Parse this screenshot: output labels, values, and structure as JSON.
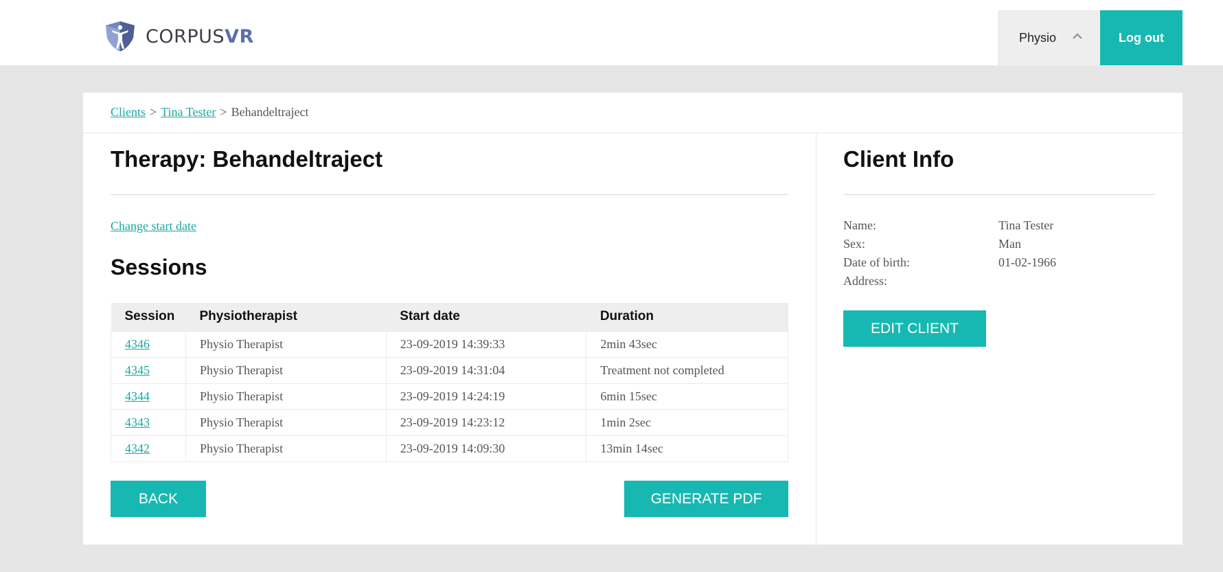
{
  "header": {
    "logo_text_a": "CORPUS",
    "logo_text_b": "VR",
    "user_name": "Physio",
    "logout_label": "Log out"
  },
  "breadcrumb": {
    "clients": "Clients",
    "separator": ">",
    "client": "Tina Tester",
    "current": "Behandeltraject"
  },
  "therapy": {
    "title": "Therapy: Behandeltraject",
    "change_start_date": "Change start date",
    "sessions_title": "Sessions"
  },
  "table": {
    "headers": [
      "Session",
      "Physiotherapist",
      "Start date",
      "Duration"
    ],
    "rows": [
      {
        "session": "4346",
        "physio": "Physio Therapist",
        "start": "23-09-2019 14:39:33",
        "duration": "2min 43sec"
      },
      {
        "session": "4345",
        "physio": "Physio Therapist",
        "start": "23-09-2019 14:31:04",
        "duration": "Treatment not completed"
      },
      {
        "session": "4344",
        "physio": "Physio Therapist",
        "start": "23-09-2019 14:24:19",
        "duration": "6min 15sec"
      },
      {
        "session": "4343",
        "physio": "Physio Therapist",
        "start": "23-09-2019 14:23:12",
        "duration": "1min 2sec"
      },
      {
        "session": "4342",
        "physio": "Physio Therapist",
        "start": "23-09-2019 14:09:30",
        "duration": "13min 14sec"
      }
    ]
  },
  "buttons": {
    "back": "BACK",
    "generate_pdf": "GENERATE PDF",
    "edit_client": "EDIT CLIENT"
  },
  "client_info": {
    "title": "Client Info",
    "name_label": "Name:",
    "name_value": "Tina Tester",
    "sex_label": "Sex:",
    "sex_value": "Man",
    "dob_label": "Date of birth:",
    "dob_value": "01-02-1966",
    "address_label": "Address:",
    "address_value": ""
  },
  "colors": {
    "accent": "#17b8b1",
    "link": "#17a9a1",
    "background": "#e6e6e6",
    "logo_vr": "#5b6fa8"
  },
  "icons": {
    "logo": "corpusvr-shield-logo",
    "user_menu": "chevron-up-icon"
  }
}
